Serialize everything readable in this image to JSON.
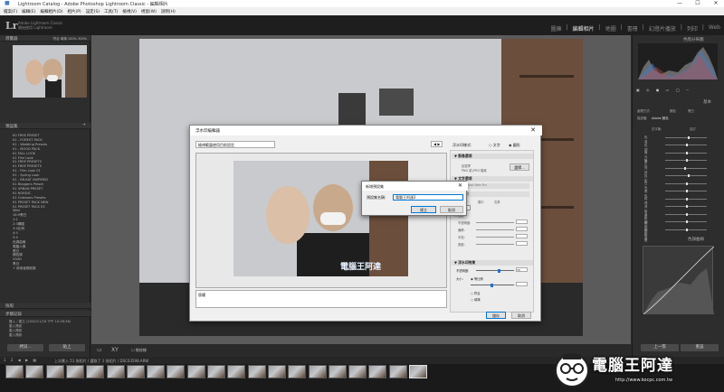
{
  "window": {
    "title": "Lightroom Catalog - Adobe Photoshop Lightroom Classic - 編輯相片",
    "minimize": "—",
    "maximize": "☐",
    "close": "✕"
  },
  "menu": [
    "檔案(F)",
    "編輯(E)",
    "編輯相片(D)",
    "相片(P)",
    "設定(S)",
    "工具(T)",
    "檢視(V)",
    "視窗(W)",
    "說明(H)"
  ],
  "identity": {
    "logo": "Lr",
    "line1": "Adobe Lightroom Classic",
    "line2": "開始使用 Lightroom"
  },
  "modules": [
    {
      "label": "圖庫",
      "active": false
    },
    {
      "label": "編輯相片",
      "active": true
    },
    {
      "label": "地圖",
      "active": false
    },
    {
      "label": "書冊",
      "active": false
    },
    {
      "label": "幻燈片播放",
      "active": false
    },
    {
      "label": "列印",
      "active": false
    },
    {
      "label": "Web",
      "active": false
    }
  ],
  "left_panel": {
    "navigator_title": "導覽器",
    "navigator_modes": "符合  填滿  100%  300%",
    "presets_title": "預設集",
    "presets": [
      "K0 FREE PRESET",
      "K1 - FOREST PACK",
      "K1 - Wedding Presets",
      "K1 - MOOD PACK",
      "K1 FALL LOOK",
      "K1 Film Look",
      "K1 FREE PRESETS",
      "K1 FREE PRESETS",
      "K1 - Film Look 01",
      "K1 - Spring Look",
      "K1 - BR-KAT INSPIRED",
      "K1 Bloggers Preset",
      "K1 URBAN PRESET",
      "K1 NORDIC",
      "K1 Outdoors Presets",
      "K1 PRESET PACK NEW",
      "K1 PRESET PACK 03",
      "Wed",
      "16:9黑白",
      "1:1",
      "2:3構圖",
      "3:4比例",
      "4:5",
      "5:4",
      "色調曲線",
      "電腦人像",
      "黑白",
      "顏色調",
      "VIVID",
      "黑白",
      "+ 使用者預設集"
    ],
    "snapshots_title": "快照",
    "history_title": "步驟記錄",
    "history": [
      "匯入 / 建立 (2020/11/18 下午 10:28:36)",
      "載入預設",
      "載入預設",
      "載入預設"
    ],
    "copy_btn": "拷貝...",
    "paste_btn": "貼上"
  },
  "toolbar": {
    "label": "軟校樣"
  },
  "dialog": {
    "title": "浮水印編輯器",
    "close": "✕",
    "template_select": "檢視範圍使用目前設定",
    "preview_caption": "版權",
    "watermark_style_label": "浮水印樣式:",
    "style_text": "文字",
    "style_graphic": "圖形",
    "image_options": "影像選項",
    "image_hint1": "請選擇",
    "image_hint2": "PNG 或 JPEG 檔案",
    "choose_btn": "選擇...",
    "text_options": "文字選項",
    "font_name": "Myriad Web Pro",
    "font_style": "標準",
    "align_left": "左齊",
    "align_center": "置中",
    "align_right": "右齊",
    "color_label": "顏色:",
    "shadow_label": "陰影",
    "opacity_label": "不透明度:",
    "offset_label": "偏移:",
    "radius_label": "半徑:",
    "angle_label": "角度:",
    "watermark_effects": "浮水印效果",
    "wm_opacity_label": "不透明度:",
    "wm_opacity_value": "70",
    "size_label": "大小:",
    "size_proportional": "等比例",
    "size_fit": "符合",
    "size_fill": "填滿",
    "ok_btn": "儲存",
    "cancel_btn": "取消"
  },
  "subdialog": {
    "title": "新增預設集",
    "name_label": "預設集名稱:",
    "name_value": "電腦王阿達2",
    "create_btn": "建立",
    "cancel_btn": "取消"
  },
  "right_panel": {
    "histogram_title": "色階分佈圖",
    "basic_title": "基本",
    "treatment_label": "處理方式:",
    "treatment_color": "顏色",
    "treatment_bw": "黑白",
    "profile_label": "描述檔:",
    "profile_value": "Adobe 顏色",
    "wb_label": "白平衡:",
    "wb_value": "自訂",
    "sliders": [
      "色溫",
      "色調",
      "曝光度",
      "對比",
      "亮部",
      "陰影",
      "白色",
      "黑色",
      "紋理",
      "清晰度",
      "去朦朧",
      "細節飽和度",
      "飽和度"
    ],
    "tone_curve_title": "色調曲線",
    "prev_btn": "上一張",
    "reset_btn": "重設"
  },
  "filmstrip": {
    "label": "上次匯入  51 張相片 / 選取了 1 張相片 / DSC03598.ARW",
    "thumb_count": 21
  },
  "watermark": {
    "brand": "電腦王阿達",
    "url": "http://www.kocpc.com.tw"
  },
  "colors": {
    "accent": "#1e6fd9",
    "panel": "#2d2d2d",
    "center": "#5b5b5b"
  }
}
